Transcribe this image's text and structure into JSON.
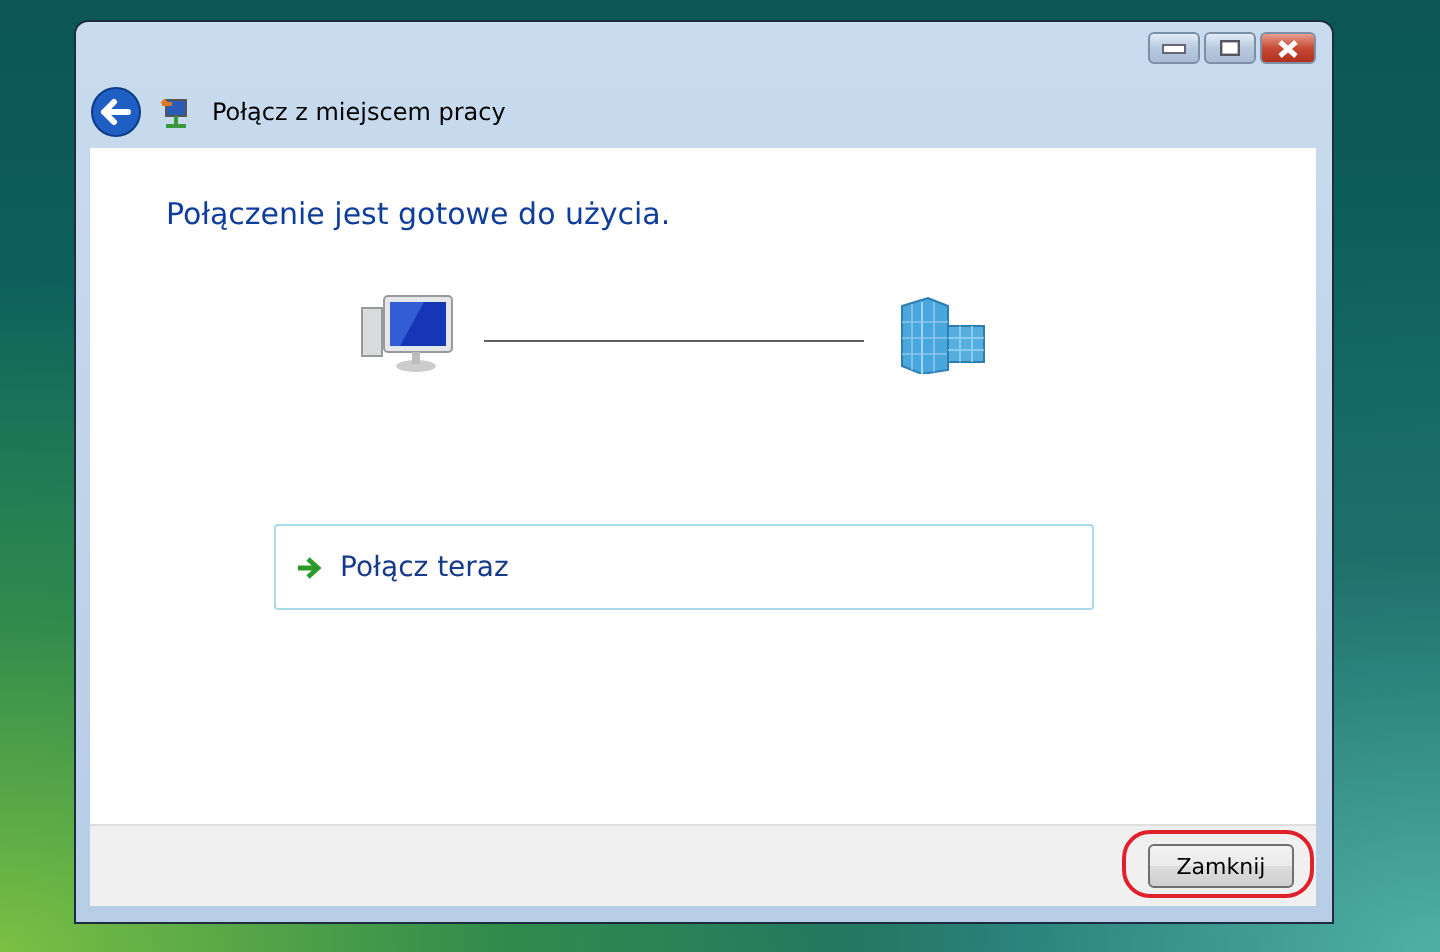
{
  "window": {
    "title": "Połącz z miejscem pracy"
  },
  "heading": "Połączenie jest gotowe do użycia.",
  "command_link": {
    "label": "Połącz teraz"
  },
  "buttons": [
    {
      "label": "Zamknij",
      "highlighted": true
    }
  ]
}
